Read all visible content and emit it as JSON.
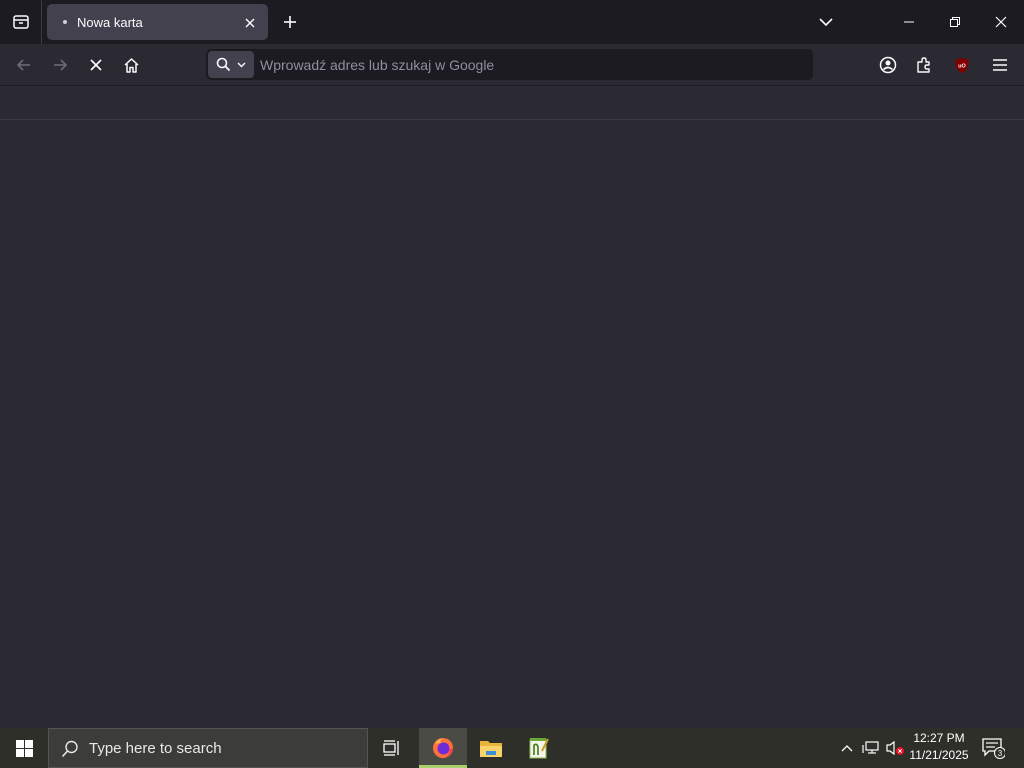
{
  "browser": {
    "tab": {
      "title": "Nowa karta"
    },
    "urlbar": {
      "placeholder": "Wprowadź adres lub szukaj w Google"
    }
  },
  "taskbar": {
    "search_placeholder": "Type here to search",
    "clock": {
      "time": "12:27 PM",
      "date": "11/21/2025"
    },
    "notification_count": "3"
  },
  "colors": {
    "tabstrip_bg": "#1c1b22",
    "toolbar_bg": "#2b2a33",
    "active_tab_bg": "#42414d",
    "taskbar_bg": "#2f2f2a",
    "active_app_indicator": "#a8d16b"
  }
}
